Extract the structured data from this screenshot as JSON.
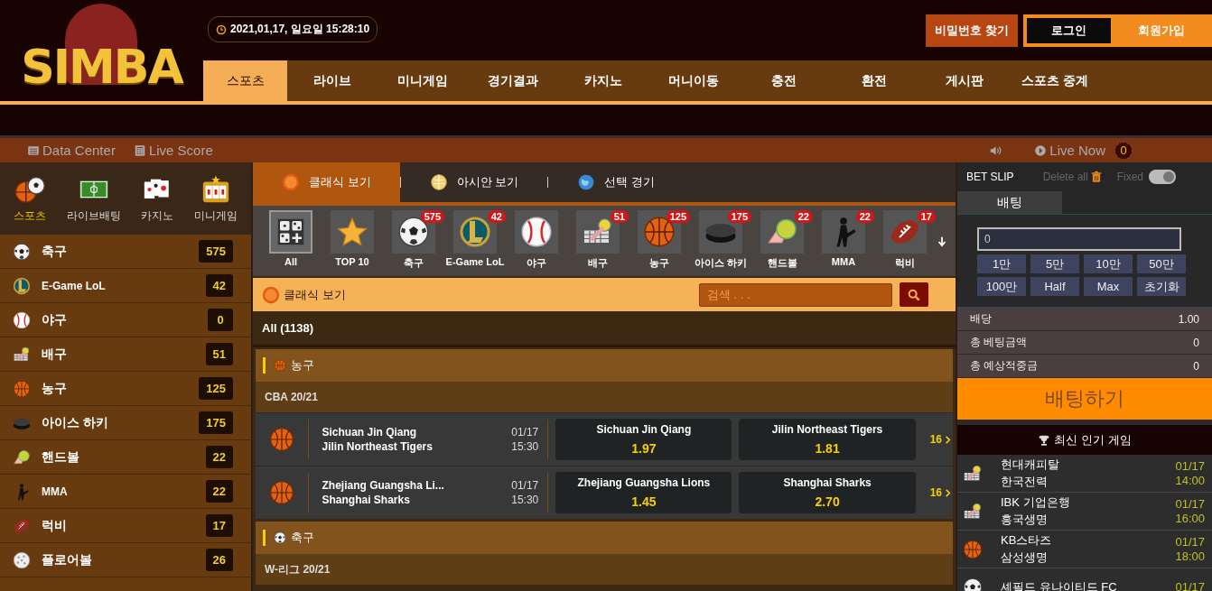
{
  "header": {
    "logo": "SIMBA",
    "clock": "2021,01,17, 일요일 15:28:10",
    "buttons": [
      {
        "label": "비밀번호 찾기",
        "kind": "find"
      },
      {
        "label": "로그인",
        "kind": "login"
      },
      {
        "label": "회원가입",
        "kind": "join"
      }
    ]
  },
  "nav": [
    {
      "label": "스포츠",
      "selected": true
    },
    {
      "label": "라이브",
      "selected": false
    },
    {
      "label": "미니게임",
      "selected": false
    },
    {
      "label": "경기결과",
      "selected": false
    },
    {
      "label": "카지노",
      "selected": false
    },
    {
      "label": "머니이동",
      "selected": false
    },
    {
      "label": "충전",
      "selected": false
    },
    {
      "label": "환전",
      "selected": false
    },
    {
      "label": "게시판",
      "selected": false
    },
    {
      "label": "스포츠 중계",
      "selected": false
    }
  ],
  "info_bar": {
    "links": [
      {
        "label": "Data Center",
        "kind": "data"
      },
      {
        "label": "Live Score",
        "kind": "score"
      }
    ],
    "live_now": "Live Now",
    "live_count": "0"
  },
  "sidebar": {
    "categories": [
      {
        "label": "스포츠",
        "kind": "sports",
        "selected": true
      },
      {
        "label": "라이브배팅",
        "kind": "field",
        "selected": false
      },
      {
        "label": "카지노",
        "kind": "cards",
        "selected": false
      },
      {
        "label": "미니게임",
        "kind": "slot",
        "selected": false
      }
    ],
    "sports": [
      {
        "name": "축구",
        "kind": "soccer",
        "count": "575"
      },
      {
        "name": "E-Game LoL",
        "kind": "lol",
        "count": "42"
      },
      {
        "name": "야구",
        "kind": "baseball",
        "count": "0"
      },
      {
        "name": "배구",
        "kind": "volleyball",
        "count": "51"
      },
      {
        "name": "농구",
        "kind": "basketball",
        "count": "125"
      },
      {
        "name": "아이스 하키",
        "kind": "hockey",
        "count": "175"
      },
      {
        "name": "핸드볼",
        "kind": "handball",
        "count": "22"
      },
      {
        "name": "MMA",
        "kind": "mma",
        "count": "22"
      },
      {
        "name": "럭비",
        "kind": "rugby",
        "count": "17"
      },
      {
        "name": "플로어볼",
        "kind": "floorball",
        "count": "26"
      }
    ]
  },
  "view_tabs": [
    {
      "label": "클래식 보기",
      "kind": "new",
      "selected": true
    },
    {
      "label": "아시안 보기",
      "kind": "asian",
      "selected": false
    },
    {
      "label": "선택 경기",
      "kind": "globe",
      "selected": false
    }
  ],
  "sport_strip": [
    {
      "label": "All",
      "kind": "dice",
      "selected": true
    },
    {
      "label": "TOP 10",
      "kind": "star",
      "selected": false
    },
    {
      "label": "축구",
      "kind": "soccer",
      "badge": "575",
      "selected": false
    },
    {
      "label": "E-Game LoL",
      "kind": "lol",
      "badge": "42",
      "selected": false
    },
    {
      "label": "야구",
      "kind": "baseball",
      "selected": false
    },
    {
      "label": "배구",
      "kind": "volleyball",
      "badge": "51",
      "selected": false
    },
    {
      "label": "농구",
      "kind": "basketball",
      "badge": "125",
      "selected": false
    },
    {
      "label": "아이스 하키",
      "kind": "hockey",
      "badge": "175",
      "selected": false
    },
    {
      "label": "핸드볼",
      "kind": "handball",
      "badge": "22",
      "selected": false
    },
    {
      "label": "MMA",
      "kind": "mma",
      "badge": "22",
      "selected": false
    },
    {
      "label": "럭비",
      "kind": "rugby",
      "badge": "17",
      "selected": false
    }
  ],
  "filter_bar": {
    "title": "클래식 보기",
    "search": {
      "placeholder": "검색 . . ."
    }
  },
  "all_count": "All (1138)",
  "sections": [
    {
      "sport": "농구",
      "kind": "basketball",
      "league": "CBA 20/21",
      "matches": [
        {
          "home": "Sichuan Jin Qiang",
          "away": "Jilin Northeast Tigers",
          "date": "01/17",
          "time": "15:30",
          "odds": [
            {
              "team": "Sichuan Jin Qiang",
              "odd": "1.97"
            },
            {
              "team": "Jilin Northeast Tigers",
              "odd": "1.81"
            }
          ],
          "more": "16"
        },
        {
          "home": "Zhejiang Guangsha Li...",
          "away": "Shanghai Sharks",
          "date": "01/17",
          "time": "15:30",
          "odds": [
            {
              "team": "Zhejiang Guangsha Lions",
              "odd": "1.45"
            },
            {
              "team": "Shanghai Sharks",
              "odd": "2.70"
            }
          ],
          "more": "16"
        }
      ]
    },
    {
      "sport": "축구",
      "kind": "soccer",
      "league": "W-리그 20/21"
    }
  ],
  "bet_slip": {
    "title": "BET SLIP",
    "delete_all": "Delete all",
    "fixed": "Fixed",
    "fixed_on": true,
    "tab": {
      "label": "배팅",
      "selected": true
    },
    "amount": "0",
    "quick_buttons": [
      "1만",
      "5만",
      "10만",
      "50만",
      "100만",
      "Half",
      "Max",
      "초기화"
    ],
    "summary": [
      {
        "label": "배당",
        "value": "1.00"
      },
      {
        "label": "총 베팅금액",
        "value": "0"
      },
      {
        "label": "총 예상적중금",
        "value": "0"
      }
    ],
    "submit": "배팅하기"
  },
  "popular": {
    "title": "최신 인기 게임",
    "games": [
      {
        "kind": "volleyball",
        "home": "현대캐피탈",
        "away": "한국전력",
        "date": "01/17",
        "time": "14:00"
      },
      {
        "kind": "volleyball",
        "home": "IBK 기업은행",
        "away": "흥국생명",
        "date": "01/17",
        "time": "16:00"
      },
      {
        "kind": "basketball",
        "home": "KB스타즈",
        "away": "삼성생명",
        "date": "01/17",
        "time": "18:00"
      },
      {
        "kind": "soccer",
        "home": "셰필드 유나이티드 FC",
        "date": "01/17"
      }
    ]
  }
}
